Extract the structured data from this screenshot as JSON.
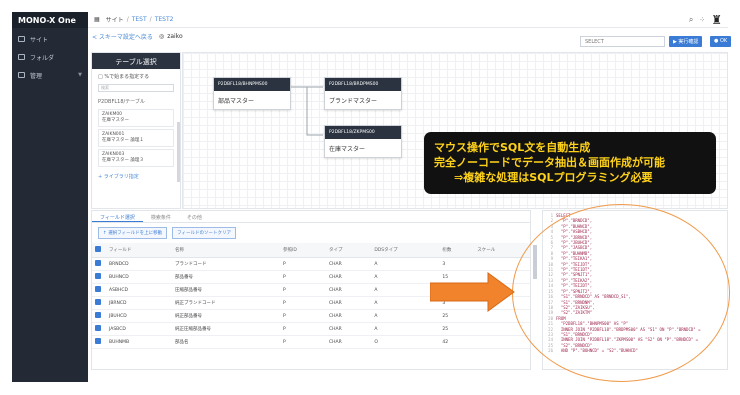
{
  "app": {
    "brand": "MONO-X One"
  },
  "sidebar": {
    "items": [
      {
        "label": "サイト",
        "icon": "home-icon"
      },
      {
        "label": "フォルダ",
        "icon": "folder-icon"
      },
      {
        "label": "管理",
        "icon": "gear-icon"
      }
    ]
  },
  "breadcrumb": {
    "items": [
      "サイト",
      "TEST",
      "TEST2"
    ]
  },
  "subheader": {
    "back": "< スキーマ設定へ戻る",
    "title": "zaiko"
  },
  "toolbar": {
    "select_value": "SELECT",
    "run_label": "▶ 実行確認",
    "ok_label": "● OK"
  },
  "table_panel": {
    "title": "テーブル選択",
    "checkbox_label": "%で始まる指定する",
    "search_placeholder": "検索",
    "section_label": "P2DBFL18/テーブル",
    "items": [
      {
        "code": "ZAIKM00",
        "name": "在庫マスター"
      },
      {
        "code": "ZAIKN001",
        "name": "在庫マスター 論理１"
      },
      {
        "code": "ZAIKN003",
        "name": "在庫マスター 論理３"
      }
    ],
    "library_link": "+ ライブラリ指定"
  },
  "nodes": [
    {
      "header": "P2DBFL18/BHNPMS00",
      "body": "部品マスター"
    },
    {
      "header": "P2DBFL18/BRDPMS00",
      "body": "ブランドマスター"
    },
    {
      "header": "P2DBFL18/ZKPMS00",
      "body": "在庫マスター"
    }
  ],
  "callout": {
    "line1": "マウス操作でSQL文を自動生成",
    "line2": "完全ノーコードでデータ抽出＆画面作成が可能",
    "line3": "⇒複雑な処理はSQLプログラミング必要"
  },
  "bottom_tabs": [
    "フィールド選択",
    "検索条件",
    "その他"
  ],
  "bottom_actions": [
    "選択フィールドを上に移動",
    "フィールドのソートクリア"
  ],
  "field_table": {
    "headers": [
      "フィールド",
      "名称",
      "参照ID",
      "タイプ",
      "DDSタイプ",
      "桁数",
      "スケール"
    ],
    "rows": [
      [
        "BRNDCD",
        "ブランドコード",
        "P",
        "CHAR",
        "A",
        "3",
        ""
      ],
      [
        "BUHNCD",
        "部品番号",
        "P",
        "CHAR",
        "A",
        "15",
        ""
      ],
      [
        "ASBHCD",
        "圧縮部品番号",
        "P",
        "CHAR",
        "A",
        "15",
        ""
      ],
      [
        "JBRNCD",
        "純正ブランドコード",
        "P",
        "CHAR",
        "A",
        "3",
        ""
      ],
      [
        "JBUHCD",
        "純正部品番号",
        "P",
        "CHAR",
        "A",
        "25",
        ""
      ],
      [
        "JASBCD",
        "純正圧縮部品番号",
        "P",
        "CHAR",
        "A",
        "25",
        ""
      ],
      [
        "BUHNMB",
        "部品名",
        "P",
        "CHAR",
        "O",
        "42",
        ""
      ]
    ]
  },
  "sql": {
    "lines": [
      "SELECT",
      "  \"P\".\"BRNDCD\",",
      "  \"P\".\"BUHNCD\",",
      "  \"P\".\"ASBHCD\",",
      "  \"P\".\"JBRNCD\",",
      "  \"P\".\"JBUHCD\",",
      "  \"P\".\"JASBCD\",",
      "  \"P\".\"BUHNMB\",",
      "  \"P\".\"TEIKA1\",",
      "  \"P\".\"TEIJDT\",",
      "  \"P\".\"TEI1DT\",",
      "  \"P\".\"SPNJT1\",",
      "  \"P\".\"TEIKA2\",",
      "  \"P\".\"TEI2DT\",",
      "  \"P\".\"SPNJT2\",",
      "  \"S1\".\"BRNDCD\" AS \"BRNDCD_S1\",",
      "  \"S1\".\"BRNDNM\",",
      "  \"S2\".\"ZAIKSU\",",
      "  \"S2\".\"ZAIKTM\"",
      "FROM",
      "  \"P2DBFL18\".\"BHNPMS00\" AS \"P\"",
      "  INNER JOIN \"P2DBFL18\".\"BRDPMS00\" AS \"S1\" ON \"P\".\"BRNDCD\" =",
      "  \"S1\".\"BRNDCD\"",
      "  INNER JOIN \"P2DBFL18\".\"ZKPMS00\" AS \"S2\" ON \"P\".\"BRNDCD\" =",
      "  \"S2\".\"BRNDCD\"",
      "  AND \"P\".\"BUHNCD\" = \"S2\".\"BUHNCD\""
    ]
  },
  "colors": {
    "accent": "#3a7bd5",
    "sidebar": "#232a36",
    "highlight": "#ffd21a",
    "arrow": "#f0832b"
  }
}
